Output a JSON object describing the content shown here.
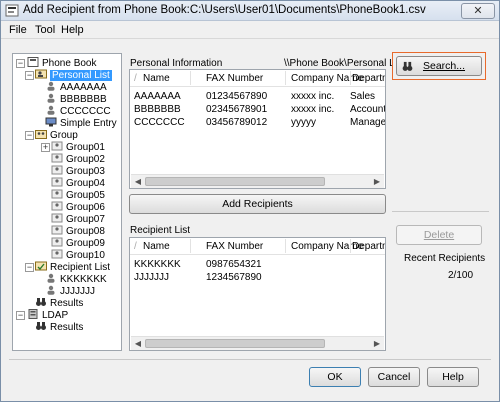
{
  "window": {
    "title": "Add Recipient from Phone Book:C:\\Users\\User01\\Documents\\PhoneBook1.csv",
    "close_label": "✕"
  },
  "menu": [
    "File",
    "Tool",
    "Help"
  ],
  "tree": {
    "root": "Phone Book",
    "personal_list": "Personal List",
    "personal_entries": [
      "AAAAAAA",
      "BBBBBBB",
      "CCCCCCC"
    ],
    "simple_entry": "Simple Entry",
    "group": "Group",
    "groups": [
      "Group01",
      "Group02",
      "Group03",
      "Group04",
      "Group05",
      "Group06",
      "Group07",
      "Group08",
      "Group09",
      "Group10"
    ],
    "recipient_list": "Recipient List",
    "recipient_entries": [
      "KKKKKKK",
      "JJJJJJJ"
    ],
    "results": "Results",
    "ldap": "LDAP",
    "ldap_results": "Results"
  },
  "personal": {
    "label": "Personal Information",
    "path": "\\\\Phone Book\\Personal List",
    "columns": [
      "Name",
      "FAX Number",
      "Company Name",
      "Departmer"
    ],
    "rows": [
      [
        "AAAAAAA",
        "01234567890",
        "xxxxx inc.",
        "Sales"
      ],
      [
        "BBBBBBB",
        "02345678901",
        "xxxxx inc.",
        "Accounting"
      ],
      [
        "CCCCCCC",
        "03456789012",
        "yyyyy",
        "Manageme"
      ]
    ]
  },
  "buttons": {
    "search": "Search...",
    "add_recipients": "Add Recipients",
    "delete": "Delete",
    "ok": "OK",
    "cancel": "Cancel",
    "help": "Help"
  },
  "recipient": {
    "label": "Recipient List",
    "columns": [
      "Name",
      "FAX Number",
      "Company Name",
      "Departmer"
    ],
    "rows": [
      [
        "KKKKKKK",
        "0987654321",
        "",
        ""
      ],
      [
        "JJJJJJJ",
        "1234567890",
        "",
        ""
      ]
    ]
  },
  "recipients_count": {
    "label": "Recent Recipients",
    "value": "2/100"
  }
}
